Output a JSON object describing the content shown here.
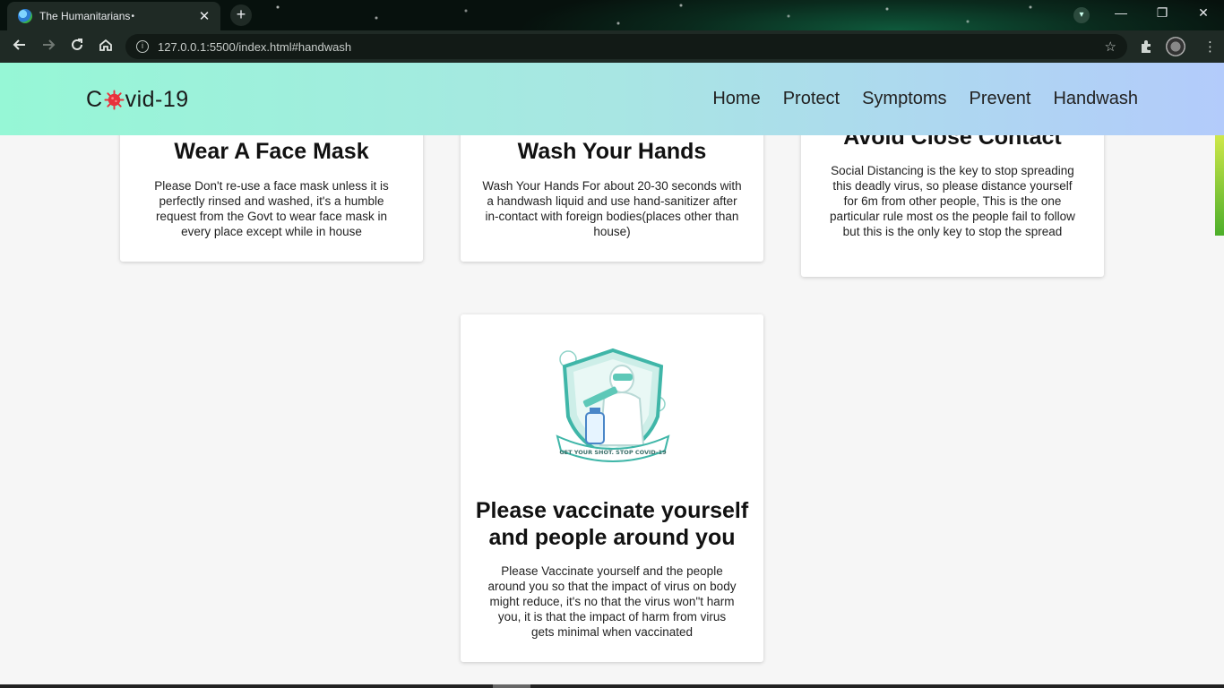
{
  "browser": {
    "tab_title": "The Humanitarians",
    "tab_audio_dot": "•",
    "close_glyph": "✕",
    "new_tab_glyph": "+",
    "url": "127.0.0.1:5500/index.html#handwash",
    "window_controls": {
      "minimize": "—",
      "restore": "❐",
      "close": "✕"
    },
    "icons": [
      "back-icon",
      "forward-icon",
      "reload-icon",
      "home-icon",
      "info-icon",
      "star-icon",
      "extensions-icon",
      "profile-icon",
      "tab-search-icon"
    ]
  },
  "site": {
    "logo_prefix": "C",
    "logo_suffix": "vid-19",
    "logo_icon": "virus-icon",
    "logo_icon_color": "#e8333c",
    "nav": [
      "Home",
      "Protect",
      "Symptoms",
      "Prevent",
      "Handwash"
    ],
    "header_gradient": [
      "#96f7d6",
      "#b3cbfb"
    ]
  },
  "cards": [
    {
      "title": "Wear A Face Mask",
      "text": "Please Don't re-use a face mask unless it is perfectly rinsed and washed, it's a humble request from the Govt to wear face mask in every place except while in house"
    },
    {
      "title": "Wash Your Hands",
      "text": "Wash Your Hands For about 20-30 seconds with a handwash liquid and use hand-sanitizer after in-contact with foreign bodies(places other than house)"
    },
    {
      "title": "Avoid Close Contact",
      "text": "Social Distancing is the key to stop spreading this deadly virus, so please distance yourself for 6m from other people, This is the one particular rule most os the people fail to follow but this is the only key to stop the spread"
    },
    {
      "title_line1": "Please vaccinate yourself",
      "title_line2": "and people around you",
      "text": "Please Vaccinate yourself and the people around you so that the impact of virus on body might reduce, it's no that the virus won\"t harm you, it is that the impact of harm from virus gets minimal when vaccinated",
      "image_caption": "GET YOUR SHOT. STOP COVID-19",
      "image_icon": "vaccine-shield-illustration"
    }
  ]
}
